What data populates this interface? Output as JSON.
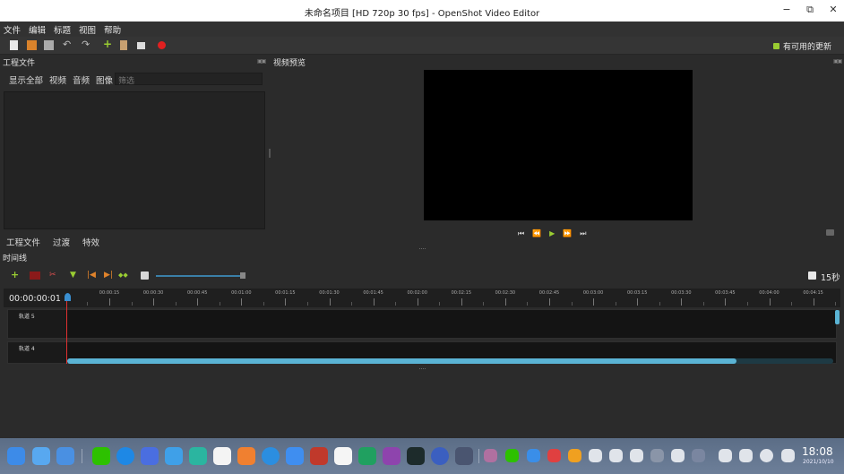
{
  "window": {
    "title": "未命名项目 [HD 720p 30 fps] - OpenShot Video Editor",
    "minimize": "−",
    "maximize": "⧉",
    "close": "✕"
  },
  "menu": [
    "文件",
    "编辑",
    "标题",
    "视图",
    "帮助"
  ],
  "toolbar": {
    "update_label": "有可用的更新",
    "update_color": "#9acd32"
  },
  "project_files": {
    "title": "工程文件",
    "filters": [
      "显示全部",
      "视频",
      "音频",
      "图像"
    ],
    "filter_placeholder": "筛选",
    "bottom_tabs": [
      "工程文件",
      "过渡",
      "特效"
    ]
  },
  "preview": {
    "title": "视频预览",
    "controls": [
      "⏮",
      "⏪",
      "▶",
      "⏩",
      "⏭"
    ]
  },
  "timeline": {
    "title": "时间线",
    "timecode": "00:00:00:01",
    "scale": "15秒",
    "ruler_labels": [
      "00:00:15",
      "00:00:30",
      "00:00:45",
      "00:01:00",
      "00:01:15",
      "00:01:30",
      "00:01:45",
      "00:02:00",
      "00:02:15",
      "00:02:30",
      "00:02:45",
      "00:03:00",
      "00:03:15",
      "00:03:30",
      "00:03:45",
      "00:04:00",
      "00:04:15"
    ],
    "tracks": [
      "轨道 5",
      "轨道 4"
    ]
  },
  "taskbar": {
    "time": "18:08",
    "date": "2021/10/10"
  }
}
